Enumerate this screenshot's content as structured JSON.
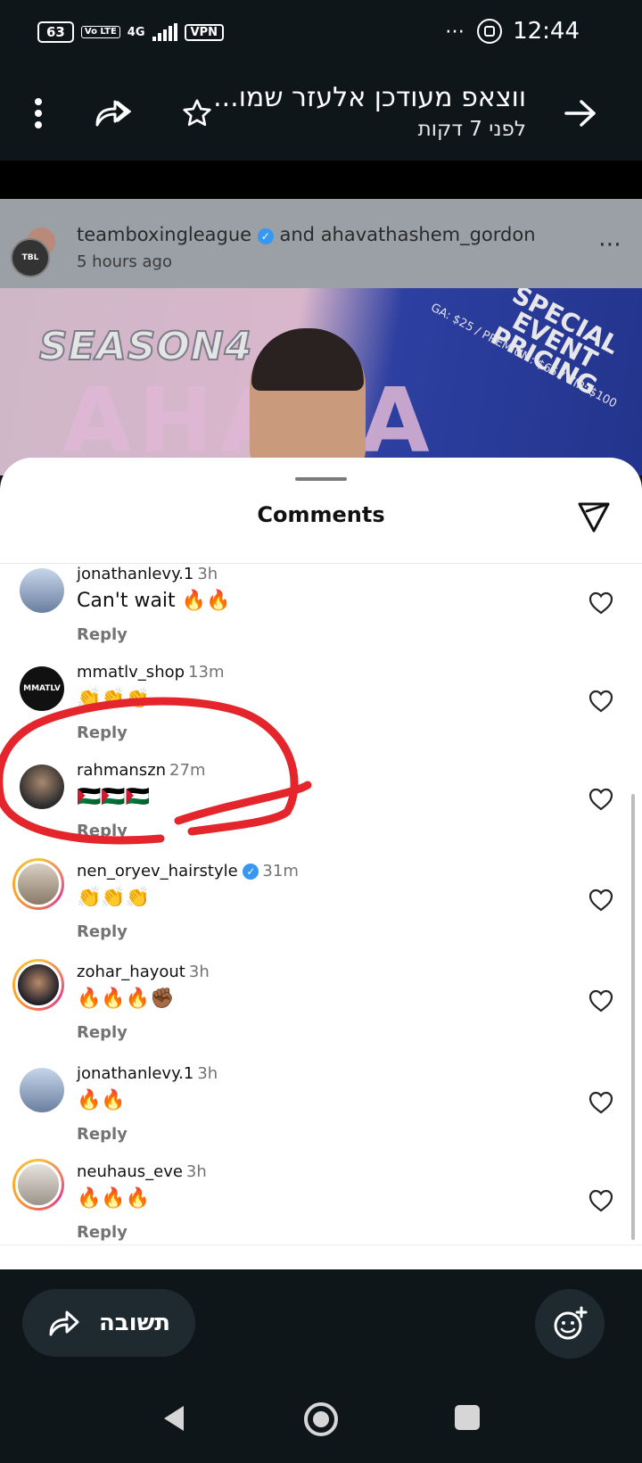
{
  "status_bar": {
    "battery": "63",
    "volte": "Vo LTE",
    "network": "4G",
    "vpn": "VPN",
    "more": "⋯",
    "time": "12:44"
  },
  "top_bar": {
    "title": "ווצאפ מעודכן אלעזר שמו...",
    "subtitle": "לפני 7 דקות"
  },
  "post_header": {
    "user1": "teamboxingleague",
    "and_text": "and",
    "user2": "ahavathashem_gordon",
    "time": "5 hours ago",
    "avatar_label": "TBL",
    "more": "⋯"
  },
  "banner": {
    "season": "SEASON4",
    "ahava": "AHAVA",
    "special": "SPECIAL EVENT PRICING",
    "prices": "GA: $25 / PREMIUM: $65 / VIP: $100"
  },
  "sheet": {
    "title": "Comments"
  },
  "comments": [
    {
      "user": "jonathanlevy.1",
      "time": "3h",
      "text": "Can't wait 🔥🔥",
      "reply": "Reply",
      "verified": false
    },
    {
      "user": "mmatlv_shop",
      "time": "13m",
      "text": "👏👏👏",
      "reply": "Reply",
      "verified": false,
      "avatar_text": "MMATLV"
    },
    {
      "user": "rahmanszn",
      "time": "27m",
      "text": "🇵🇸🇵🇸🇵🇸",
      "reply": "Reply",
      "verified": false
    },
    {
      "user": "nen_oryev_hairstyle",
      "time": "31m",
      "text": "👏👏👏",
      "reply": "Reply",
      "verified": true
    },
    {
      "user": "zohar_hayout",
      "time": "3h",
      "text": "🔥🔥🔥✊🏾",
      "reply": "Reply",
      "verified": false
    },
    {
      "user": "jonathanlevy.1",
      "time": "3h",
      "text": "🔥🔥",
      "reply": "Reply",
      "verified": false
    },
    {
      "user": "neuhaus_eve",
      "time": "3h",
      "text": "🔥🔥🔥",
      "reply": "Reply",
      "verified": false
    }
  ],
  "bottom": {
    "reply_label": "תשובה"
  },
  "colors": {
    "dark_bg": "#0f161a",
    "pill_bg": "#1f2a30",
    "annotation_red": "#e4262c",
    "verified_blue": "#3897f0"
  }
}
